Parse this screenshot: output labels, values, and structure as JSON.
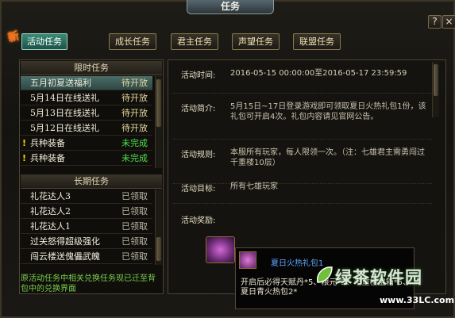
{
  "window": {
    "title": "任务",
    "help": "?",
    "close": "×"
  },
  "new_badge": "新",
  "tabs": [
    {
      "label": "活动任务",
      "active": true
    },
    {
      "label": "成长任务",
      "active": false
    },
    {
      "label": "君主任务",
      "active": false
    },
    {
      "label": "声望任务",
      "active": false
    },
    {
      "label": "联盟任务",
      "active": false
    }
  ],
  "limited_section": {
    "header": "限时任务",
    "items": [
      {
        "name": "五月初夏送福利",
        "status": "待开放",
        "flag": ""
      },
      {
        "name": "5月14日在线送礼",
        "status": "待开放",
        "flag": ""
      },
      {
        "name": "5月13日在线送礼",
        "status": "待开放",
        "flag": ""
      },
      {
        "name": "5月12日在线送礼",
        "status": "待开放",
        "flag": ""
      },
      {
        "name": "兵种装备",
        "status": "未完成",
        "flag": "!"
      },
      {
        "name": "兵种装备",
        "status": "未完成",
        "flag": "!"
      }
    ]
  },
  "long_section": {
    "header": "长期任务",
    "items": [
      {
        "name": "礼花达人3",
        "status": "已领取"
      },
      {
        "name": "礼花达人2",
        "status": "已领取"
      },
      {
        "name": "礼花达人1",
        "status": "已领取"
      },
      {
        "name": "过关怒得超级强化",
        "status": "已领取"
      },
      {
        "name": "闯云楼送傀儡武魄",
        "status": "已领取"
      }
    ]
  },
  "left_note": "原活动任务中相关兑换任务现已迁至背包中的兑换界面",
  "detail": {
    "time_label": "活动时间:",
    "time_value": "2016-05-15 00:00:00至2016-05-17 23:59:59",
    "intro_label": "活动简介:",
    "intro_value": "5月15日~17日登录游戏即可领取夏日火热礼包1份，该礼包可开启4次。礼包内容请见官网公告。",
    "rule_label": "活动规则:",
    "rule_value": "本服所有玩家，每人限领一次。（注：七雄君主需勇闯过千重楼10层）",
    "target_label": "活动目标:",
    "target_value": "所有七雄玩家",
    "reward_label": "活动奖励:"
  },
  "tooltip": {
    "title": "夏日火热礼包1",
    "desc": "开启后必得天赋丹*5、粮元*5、千重楼宝箱*5、夏日青火热包2*"
  },
  "watermark": {
    "logo": "绿茶软件园",
    "url": "www.33LC.com"
  },
  "colors": {
    "accent_tab": "#3c8a78",
    "incomplete": "#4fe04f",
    "link_title": "#5ea7ff",
    "note": "#7bd04a"
  }
}
